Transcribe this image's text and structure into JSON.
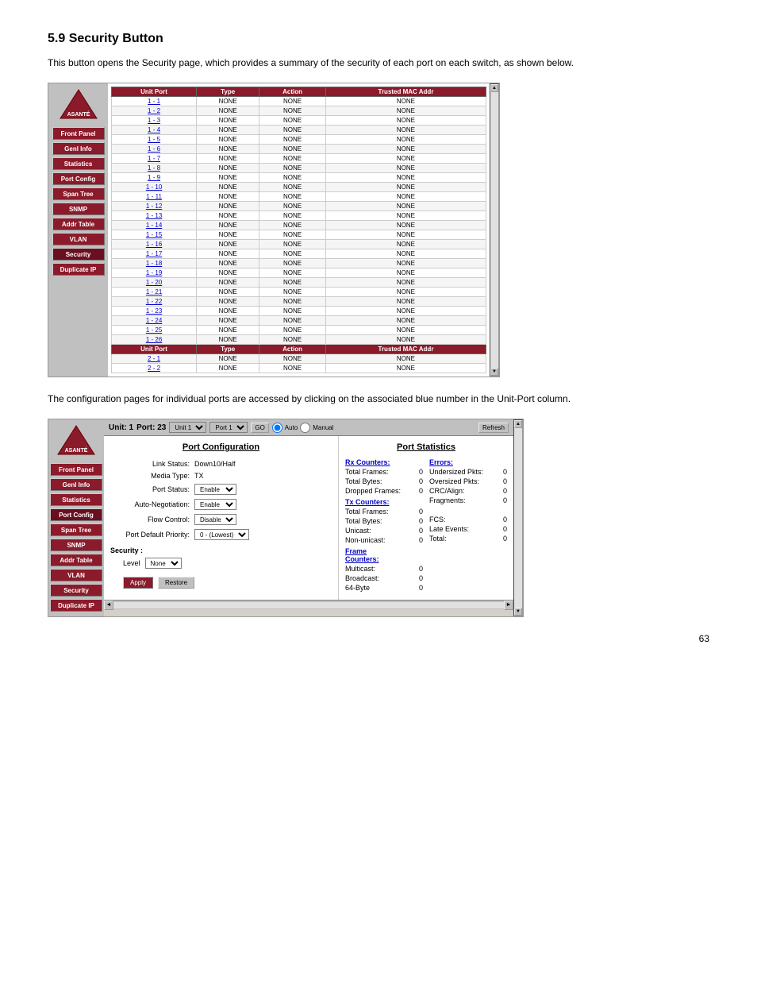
{
  "page": {
    "section": "5.9 Security Button",
    "intro": "This button opens the Security page, which provides a summary of the security of each port on each switch, as shown below.",
    "caption": "The configuration pages for individual ports are accessed by clicking on the associated blue number in the Unit-Port column.",
    "page_number": "63"
  },
  "sidebar1": {
    "buttons": [
      "Front Panel",
      "Genl Info",
      "Statistics",
      "Port Config",
      "Span Tree",
      "SNMP",
      "Addr Table",
      "VLAN",
      "Security",
      "Duplicate IP"
    ]
  },
  "security_table": {
    "headers": [
      "Unit Port",
      "Type",
      "Action",
      "Trusted MAC Addr"
    ],
    "rows": [
      [
        "1 - 1",
        "NONE",
        "NONE",
        "NONE"
      ],
      [
        "1 - 2",
        "NONE",
        "NONE",
        "NONE"
      ],
      [
        "1 - 3",
        "NONE",
        "NONE",
        "NONE"
      ],
      [
        "1 - 4",
        "NONE",
        "NONE",
        "NONE"
      ],
      [
        "1 - 5",
        "NONE",
        "NONE",
        "NONE"
      ],
      [
        "1 - 6",
        "NONE",
        "NONE",
        "NONE"
      ],
      [
        "1 - 7",
        "NONE",
        "NONE",
        "NONE"
      ],
      [
        "1 - 8",
        "NONE",
        "NONE",
        "NONE"
      ],
      [
        "1 - 9",
        "NONE",
        "NONE",
        "NONE"
      ],
      [
        "1 - 10",
        "NONE",
        "NONE",
        "NONE"
      ],
      [
        "1 - 11",
        "NONE",
        "NONE",
        "NONE"
      ],
      [
        "1 - 12",
        "NONE",
        "NONE",
        "NONE"
      ],
      [
        "1 - 13",
        "NONE",
        "NONE",
        "NONE"
      ],
      [
        "1 - 14",
        "NONE",
        "NONE",
        "NONE"
      ],
      [
        "1 - 15",
        "NONE",
        "NONE",
        "NONE"
      ],
      [
        "1 - 16",
        "NONE",
        "NONE",
        "NONE"
      ],
      [
        "1 - 17",
        "NONE",
        "NONE",
        "NONE"
      ],
      [
        "1 - 18",
        "NONE",
        "NONE",
        "NONE"
      ],
      [
        "1 - 19",
        "NONE",
        "NONE",
        "NONE"
      ],
      [
        "1 - 20",
        "NONE",
        "NONE",
        "NONE"
      ],
      [
        "1 - 21",
        "NONE",
        "NONE",
        "NONE"
      ],
      [
        "1 - 22",
        "NONE",
        "NONE",
        "NONE"
      ],
      [
        "1 - 23",
        "NONE",
        "NONE",
        "NONE"
      ],
      [
        "1 - 24",
        "NONE",
        "NONE",
        "NONE"
      ],
      [
        "1 - 25",
        "NONE",
        "NONE",
        "NONE"
      ],
      [
        "1 - 26",
        "NONE",
        "NONE",
        "NONE"
      ]
    ],
    "footer_headers": [
      "Unit Port",
      "Type",
      "Action",
      "Trusted MAC Addr"
    ],
    "extra_rows": [
      [
        "2 - 1",
        "NONE",
        "NONE",
        "NONE"
      ],
      [
        "2 - 2",
        "NONE",
        "NONE",
        "NONE"
      ]
    ]
  },
  "port_config_screen": {
    "toolbar": {
      "unit_label": "Unit: 1",
      "port_label": "Port: 23",
      "unit_select_default": "Unit 1",
      "port_select_default": "Port 1",
      "go_label": "GO",
      "auto_label": "Auto",
      "manual_label": "Manual",
      "refresh_label": "Refresh"
    },
    "port_config": {
      "title": "Port Configuration",
      "fields": [
        {
          "label": "Link Status:",
          "value": "Down10/Half"
        },
        {
          "label": "Media Type:",
          "value": "TX"
        },
        {
          "label": "Port Status:",
          "value": "Enable",
          "type": "select"
        },
        {
          "label": "Auto-Negotiation:",
          "value": "Enable",
          "type": "select"
        },
        {
          "label": "Flow Control:",
          "value": "Disable",
          "type": "select"
        },
        {
          "label": "Port Default Priority:",
          "value": "0 - (Lowest)",
          "type": "select"
        }
      ],
      "security": {
        "header": "Security :",
        "level_label": "Level",
        "level_value": "None"
      },
      "buttons": {
        "apply": "Apply",
        "restore": "Restore"
      }
    },
    "port_statistics": {
      "title": "Port Statistics",
      "rx_counters": "Rx Counters:",
      "errors_label": "Errors:",
      "total_frames_label": "Total Frames:",
      "total_frames_value": "0",
      "undersized_pkts_label": "Undersized Pkts:",
      "undersized_pkts_value": "0",
      "total_bytes_label": "Total Bytes:",
      "total_bytes_value": "0",
      "oversized_pkts_label": "Oversized Pkts:",
      "oversized_pkts_value": "0",
      "dropped_frames_label": "Dropped Frames:",
      "dropped_frames_value": "0",
      "crc_align_label": "CRC/Align:",
      "crc_align_value": "0",
      "fragments_label": "Fragments:",
      "fragments_value": "0",
      "tx_counters": "Tx Counters:",
      "fcs_label": "FCS:",
      "fcs_value": "0",
      "tx_total_frames_label": "Total Frames:",
      "tx_total_frames_value": "0",
      "late_events_label": "Late Events:",
      "late_events_value": "0",
      "tx_total_bytes_label": "Total Bytes:",
      "tx_total_bytes_value": "0",
      "total_label": "Total:",
      "total_value": "0",
      "unicast_label": "Unicast:",
      "unicast_value": "0",
      "non_unicast_label": "Non-unicast:",
      "non_unicast_value": "0",
      "frame_counters_label": "Frame Counters:",
      "multicast_label": "Multicast:",
      "multicast_value": "0",
      "broadcast_label": "Broadcast:",
      "broadcast_value": "0",
      "byte64_label": "64-Byte",
      "byte64_value": "0"
    }
  }
}
